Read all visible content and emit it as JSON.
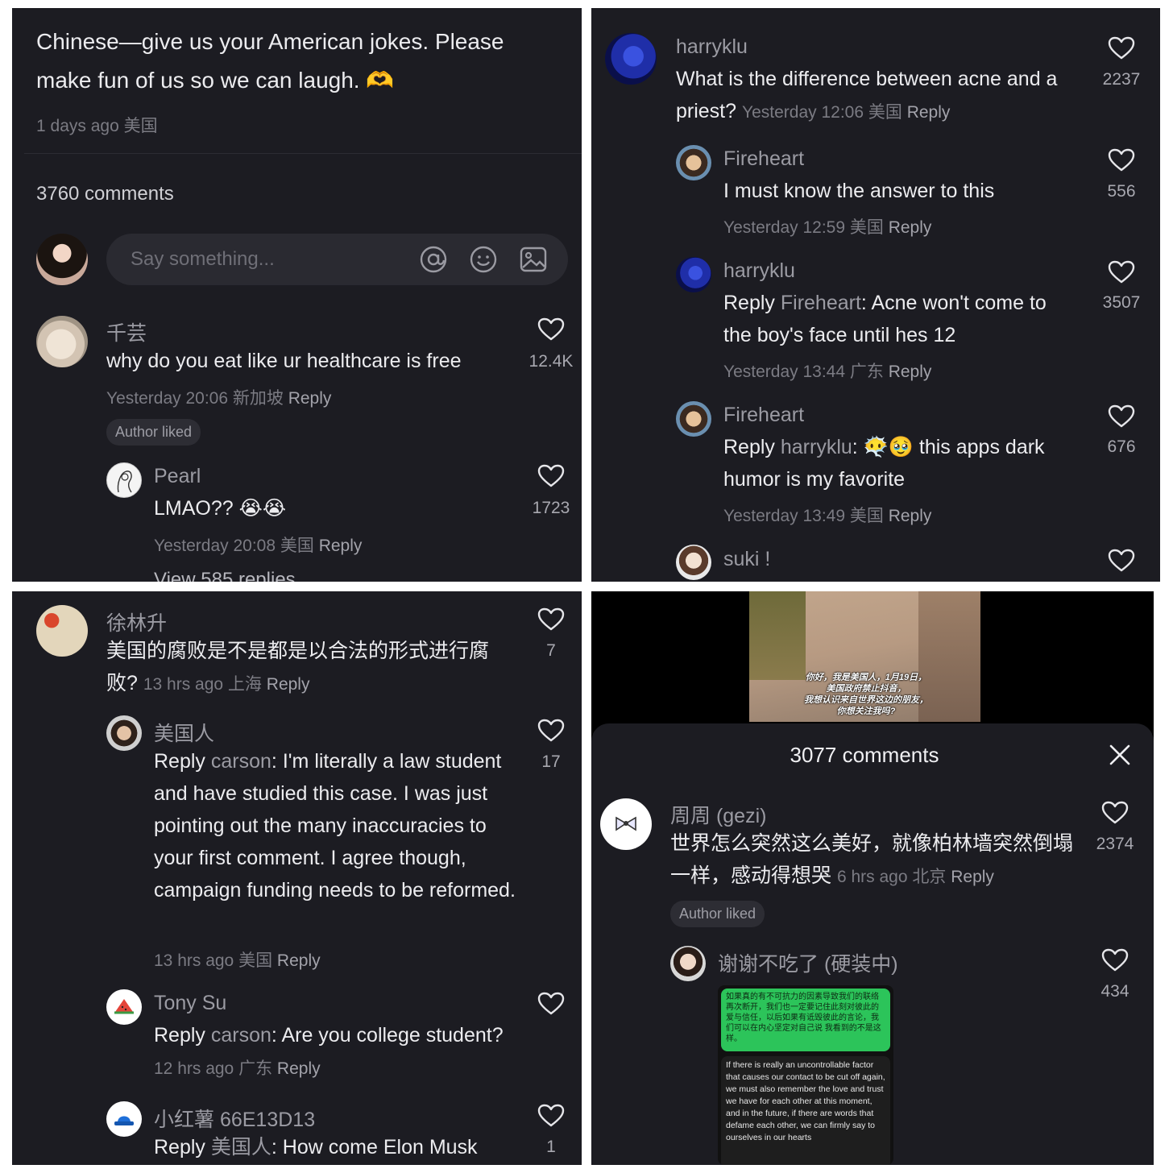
{
  "panel1": {
    "post_caption": "Chinese—give us your American jokes. Please make fun of us so we can laugh. 🫶",
    "post_meta": "1 days ago 美国",
    "comments_count": "3760 comments",
    "input_placeholder": "Say something...",
    "comments": [
      {
        "name": "千芸",
        "text": "why do you eat like ur healthcare is free",
        "meta": "Yesterday 20:06 新加坡",
        "reply": "Reply",
        "likes": "12.4K",
        "badge": "Author liked"
      },
      {
        "name": "Pearl",
        "text": "LMAO?? 😭😭",
        "meta": "Yesterday 20:08 美国",
        "reply": "Reply",
        "likes": "1723"
      }
    ],
    "view_replies": "View 585 replies"
  },
  "panel2": {
    "comments": [
      {
        "name": "harryklu",
        "text": "What is the difference between acne and a priest?",
        "meta": "Yesterday 12:06 美国",
        "reply": "Reply",
        "likes": "2237"
      },
      {
        "name": "Fireheart",
        "text": "I must know the answer to this",
        "meta": "Yesterday 12:59 美国",
        "reply": "Reply",
        "likes": "556"
      },
      {
        "name": "harryklu",
        "reply_prefix": "Reply",
        "reply_to": "Fireheart",
        "text": "Acne won't come to the boy's face until hes 12",
        "meta": "Yesterday 13:44 广东",
        "reply": "Reply",
        "likes": "3507"
      },
      {
        "name": "Fireheart",
        "reply_prefix": "Reply",
        "reply_to": "harryklu",
        "text": "😶‍🌫️🥹 this apps dark humor is my favorite",
        "meta": "Yesterday 13:49 美国",
        "reply": "Reply",
        "likes": "676"
      },
      {
        "name": "suki !"
      }
    ]
  },
  "panel3": {
    "comments": [
      {
        "name": "徐林升",
        "text": "美国的腐败是不是都是以合法的形式进行腐败?",
        "meta": "13 hrs ago 上海",
        "reply": "Reply",
        "likes": "7"
      },
      {
        "name": "美国人",
        "reply_prefix": "Reply",
        "reply_to": "carson",
        "text": "I'm literally a law student and have studied this case. I was just pointing out the many inaccuracies to your first comment. I agree though, campaign funding needs to be reformed.",
        "meta": "13 hrs ago 美国",
        "reply": "Reply",
        "likes": "17"
      },
      {
        "name": "Tony Su",
        "reply_prefix": "Reply",
        "reply_to": "carson",
        "text": "Are you college student?",
        "meta": "12 hrs ago 广东",
        "reply": "Reply"
      },
      {
        "name": "小红薯 66E13D13",
        "reply_prefix": "Reply",
        "reply_to": "美国人",
        "text": "How come Elon Musk",
        "likes": "1"
      }
    ]
  },
  "panel4": {
    "video_caption": "你好，我是美国人，1月19日，\n美国政府禁止抖音，\n我想认识来自世界这边的朋友，\n你想关注我吗?",
    "comments_count": "3077 comments",
    "comments": [
      {
        "name": "周周 (gezi)",
        "text": "世界怎么突然这么美好，就像柏林墙突然倒塌一样，感动得想哭",
        "meta": "6 hrs ago 北京",
        "reply": "Reply",
        "likes": "2374",
        "badge": "Author liked"
      },
      {
        "name": "谢谢不吃了 (硬装中)",
        "likes": "434"
      }
    ],
    "chat_image": {
      "green_text": "如果真的有不可抗力的因素导致我们的联络再次断开，我们也一定要记住此刻对彼此的爱与信任，以后如果有诋毁彼此的言论，我们可以在内心坚定对自己说 我看到的不是这样。",
      "dark_text": "If there is really an uncontrollable factor that causes our contact to be cut off again, we must also remember the love and trust we have for each other at this moment, and in the future, if there are words that defame each other, we can firmly say to ourselves in our hearts"
    }
  },
  "colors": {
    "panel_bg": "#1c1c22",
    "text": "#ececef",
    "muted": "#7b7b83",
    "chat_green": "#2cc45a"
  }
}
